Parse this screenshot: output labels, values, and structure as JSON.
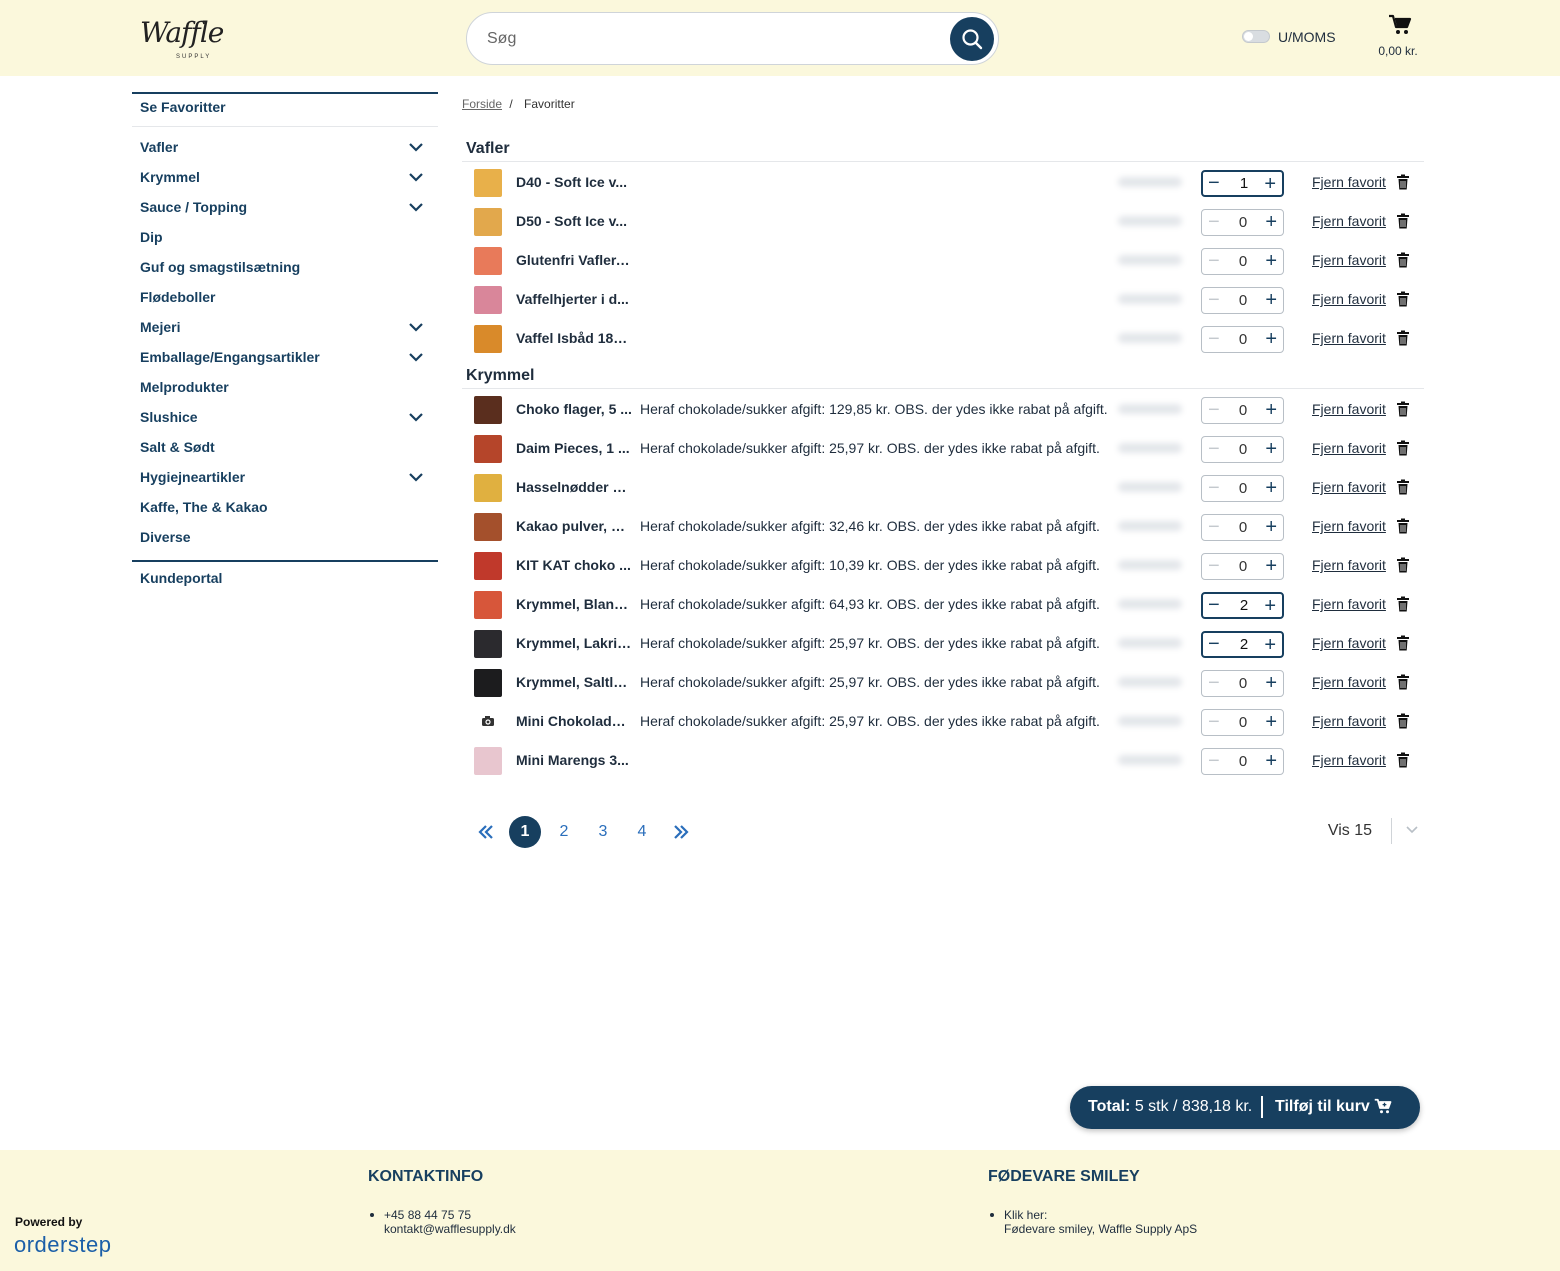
{
  "header": {
    "logo_text": "Waffle",
    "logo_subtext": "SUPPLY",
    "search_placeholder": "Søg",
    "vat_toggle_label": "U/MOMS",
    "cart_total": "0,00 kr."
  },
  "sidebar": {
    "favorites_link": "Se Favoritter",
    "categories": [
      {
        "label": "Vafler",
        "has_children": true
      },
      {
        "label": "Krymmel",
        "has_children": true
      },
      {
        "label": "Sauce / Topping",
        "has_children": true
      },
      {
        "label": "Dip",
        "has_children": false
      },
      {
        "label": "Guf og smagstilsætning",
        "has_children": false
      },
      {
        "label": "Flødeboller",
        "has_children": false
      },
      {
        "label": "Mejeri",
        "has_children": true
      },
      {
        "label": "Emballage/Engangsartikler",
        "has_children": true
      },
      {
        "label": "Melprodukter",
        "has_children": false
      },
      {
        "label": "Slushice",
        "has_children": true
      },
      {
        "label": "Salt & Sødt",
        "has_children": false
      },
      {
        "label": "Hygiejneartikler",
        "has_children": true
      },
      {
        "label": "Kaffe, The & Kakao",
        "has_children": false
      },
      {
        "label": "Diverse",
        "has_children": false
      }
    ],
    "portal_link": "Kundeportal"
  },
  "breadcrumb": {
    "home": "Forside",
    "separator": "/",
    "current": "Favoritter"
  },
  "remove_label": "Fjern favorit",
  "groups": [
    {
      "title": "Vafler",
      "items": [
        {
          "name": "D40 - Soft Ice v...",
          "note": "",
          "qty": "1",
          "active": true,
          "thumb": "#e8b04a"
        },
        {
          "name": "D50 - Soft Ice v...",
          "note": "",
          "qty": "0",
          "active": false,
          "thumb": "#e2a84c"
        },
        {
          "name": "Glutenfri Vafler, ...",
          "note": "",
          "qty": "0",
          "active": false,
          "thumb": "#e87a5a"
        },
        {
          "name": "Vaffelhjerter i d...",
          "note": "",
          "qty": "0",
          "active": false,
          "thumb": "#d9869a"
        },
        {
          "name": "Vaffel Isbåd 180...",
          "note": "",
          "qty": "0",
          "active": false,
          "thumb": "#d98a2a"
        }
      ]
    },
    {
      "title": "Krymmel",
      "items": [
        {
          "name": "Choko flager, 5 ...",
          "note": "Heraf chokolade/sukker afgift: 129,85 kr. OBS. der ydes ikke rabat på afgift.",
          "qty": "0",
          "active": false,
          "thumb": "#5a2e1e"
        },
        {
          "name": "Daim Pieces, 1 ...",
          "note": "Heraf chokolade/sukker afgift: 25,97 kr. OBS. der ydes ikke rabat på afgift.",
          "qty": "0",
          "active": false,
          "thumb": "#b5452a"
        },
        {
          "name": "Hasselnødder h...",
          "note": "",
          "qty": "0",
          "active": false,
          "thumb": "#e0b040"
        },
        {
          "name": "Kakao pulver, 1,...",
          "note": "Heraf chokolade/sukker afgift: 32,46 kr. OBS. der ydes ikke rabat på afgift.",
          "qty": "0",
          "active": false,
          "thumb": "#a4502c"
        },
        {
          "name": "KIT KAT choko ...",
          "note": "Heraf chokolade/sukker afgift: 10,39 kr. OBS. der ydes ikke rabat på afgift.",
          "qty": "0",
          "active": false,
          "thumb": "#c0392b"
        },
        {
          "name": "Krymmel, Bland...",
          "note": "Heraf chokolade/sukker afgift: 64,93 kr. OBS. der ydes ikke rabat på afgift.",
          "qty": "2",
          "active": true,
          "thumb": "#d7563a"
        },
        {
          "name": "Krymmel, Lakrid...",
          "note": "Heraf chokolade/sukker afgift: 25,97 kr. OBS. der ydes ikke rabat på afgift.",
          "qty": "2",
          "active": true,
          "thumb": "#2b2a2e"
        },
        {
          "name": "Krymmel, Saltla...",
          "note": "Heraf chokolade/sukker afgift: 25,97 kr. OBS. der ydes ikke rabat på afgift.",
          "qty": "0",
          "active": false,
          "thumb": "#1c1c1e"
        },
        {
          "name": "Mini Chokolade ...",
          "note": "Heraf chokolade/sukker afgift: 25,97 kr. OBS. der ydes ikke rabat på afgift.",
          "qty": "0",
          "active": false,
          "thumb": "camera"
        },
        {
          "name": "Mini Marengs 3...",
          "note": "",
          "qty": "0",
          "active": false,
          "thumb": "#e8c6cf"
        }
      ]
    }
  ],
  "pagination": {
    "pages": [
      "1",
      "2",
      "3",
      "4"
    ],
    "current": "1",
    "page_size_label": "Vis 15"
  },
  "total_bar": {
    "label": "Total:",
    "value": "5 stk / 838,18 kr.",
    "action": "Tilføj til kurv"
  },
  "footer": {
    "powered_by": "Powered by",
    "brand": "orderstep",
    "contact_heading": "KONTAKTINFO",
    "phone": "+45 88 44 75 75",
    "email": "kontakt@wafflesupply.dk",
    "smiley_heading": "FØDEVARE SMILEY",
    "smiley_line1": "Klik her:",
    "smiley_line2": "Fødevare smiley, Waffle Supply ApS"
  },
  "colors": {
    "brand_navy": "#173f5f",
    "header_bg": "#fbf8dc",
    "link_blue": "#2a6ebb"
  }
}
